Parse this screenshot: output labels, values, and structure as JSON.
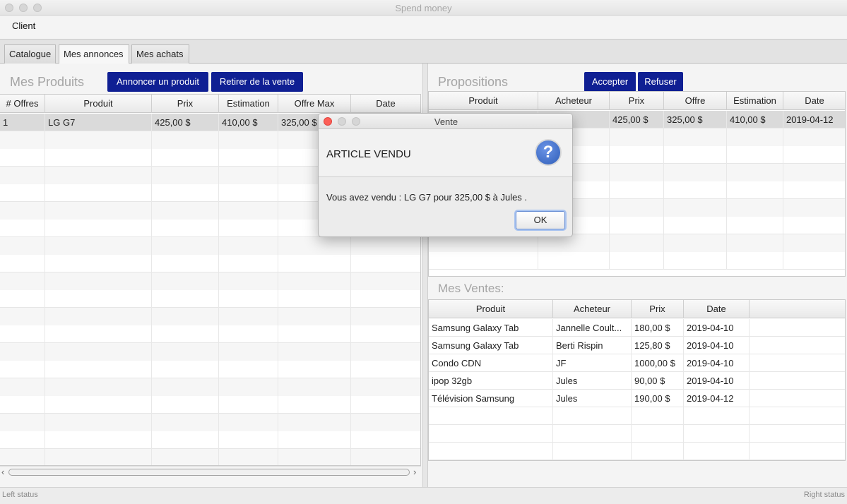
{
  "window": {
    "title": "Spend money"
  },
  "menu": {
    "client": "Client"
  },
  "tabs": [
    {
      "label": "Catalogue"
    },
    {
      "label": "Mes annonces"
    },
    {
      "label": "Mes achats"
    }
  ],
  "products": {
    "title": "Mes Produits",
    "announce_button": "Annoncer un produit",
    "remove_button": "Retirer de la vente",
    "columns": [
      "# Offres",
      "Produit",
      "Prix",
      "Estimation",
      "Offre Max",
      "Date"
    ],
    "rows": [
      {
        "offres": "1",
        "produit": "LG G7",
        "prix": "425,00 $",
        "estimation": "410,00 $",
        "offre_max": "325,00 $",
        "date": ""
      }
    ]
  },
  "propositions": {
    "title": "Propositions",
    "accept_button": "Accepter",
    "refuse_button": "Refuser",
    "columns": [
      "Produit",
      "Acheteur",
      "Prix",
      "Offre",
      "Estimation",
      "Date"
    ],
    "rows": [
      {
        "produit": "",
        "acheteur": "",
        "prix": "425,00 $",
        "offre": "325,00 $",
        "estimation": "410,00 $",
        "date": "2019-04-12"
      }
    ]
  },
  "sales": {
    "title": "Mes Ventes:",
    "columns": [
      "Produit",
      "Acheteur",
      "Prix",
      "Date"
    ],
    "rows": [
      {
        "produit": "Samsung Galaxy Tab",
        "acheteur": "Jannelle Coult...",
        "prix": "180,00 $",
        "date": "2019-04-10"
      },
      {
        "produit": "Samsung Galaxy Tab",
        "acheteur": "Berti Rispin",
        "prix": "125,80 $",
        "date": "2019-04-10"
      },
      {
        "produit": "Condo CDN",
        "acheteur": "JF",
        "prix": "1000,00 $",
        "date": "2019-04-10"
      },
      {
        "produit": "ipop 32gb",
        "acheteur": "Jules",
        "prix": "90,00 $",
        "date": "2019-04-10"
      },
      {
        "produit": "Télévision Samsung",
        "acheteur": "Jules",
        "prix": "190,00 $",
        "date": "2019-04-12"
      }
    ]
  },
  "status": {
    "left": "Left status",
    "right": "Right status"
  },
  "dialog": {
    "title": "Vente",
    "header": "ARTICLE VENDU",
    "icon": "question-icon",
    "message": "Vous avez vendu : LG G7 pour 325,00 $ à Jules .",
    "ok_button": "OK"
  },
  "colors": {
    "accent_button": "#0f1f93",
    "close_red": "#fc5f57"
  }
}
